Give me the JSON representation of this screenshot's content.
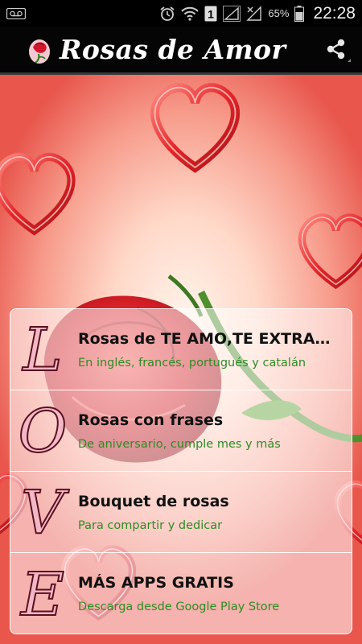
{
  "status_bar": {
    "battery": "65%",
    "time": "22:28",
    "sim_badge": "1"
  },
  "app_bar": {
    "title": "Rosas de Amor",
    "share_icon": "share-icon",
    "logo_icon": "rose-logo-icon"
  },
  "menu": {
    "items": [
      {
        "letter": "L",
        "title": "Rosas de TE AMO,TE EXTRAÑO...",
        "subtitle": "En inglés, francés, portugués y catalán"
      },
      {
        "letter": "O",
        "title": "Rosas con frases",
        "subtitle": "De aniversario, cumple mes y más"
      },
      {
        "letter": "V",
        "title": "Bouquet de rosas",
        "subtitle": "Para compartir y dedicar"
      },
      {
        "letter": "E",
        "title": "MÁS APPS GRATIS",
        "subtitle": "Descarga desde Google Play Store"
      }
    ]
  },
  "colors": {
    "subtitle_green": "#2e8b22",
    "heart_red": "#e4262a",
    "letter_red": "#c2334a"
  }
}
